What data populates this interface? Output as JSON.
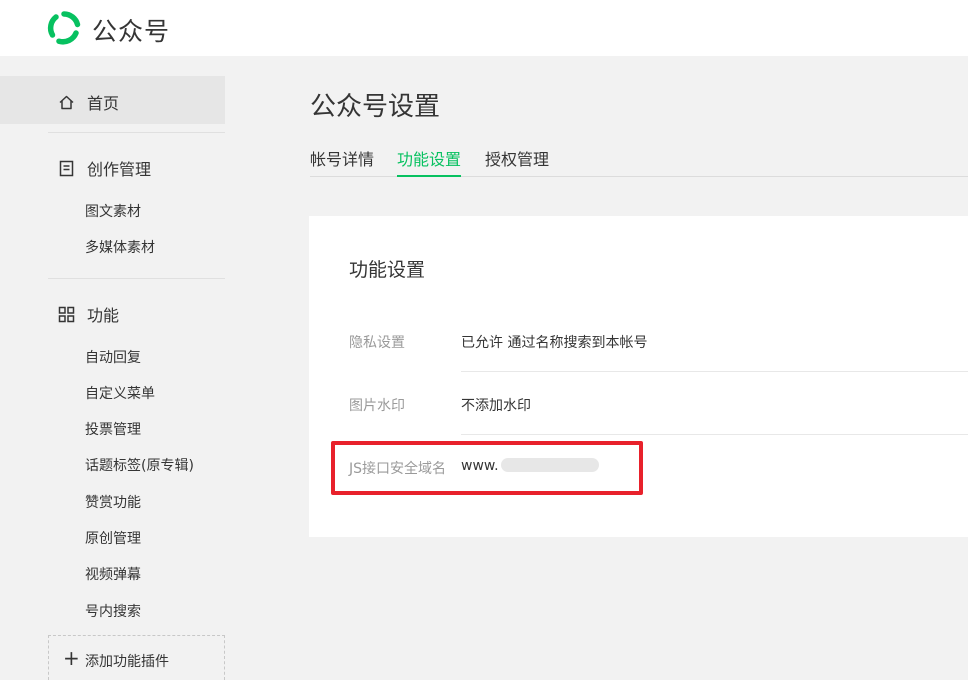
{
  "header": {
    "brand": "公众号",
    "logo_icon": "wechat-official-account-logo-icon",
    "accent_color": "#07c160"
  },
  "sidebar": {
    "home": {
      "label": "首页",
      "icon": "home-icon"
    },
    "creation": {
      "label": "创作管理",
      "icon": "document-icon",
      "items": [
        "图文素材",
        "多媒体素材"
      ]
    },
    "features": {
      "label": "功能",
      "icon": "grid-icon",
      "items": [
        "自动回复",
        "自定义菜单",
        "投票管理",
        "话题标签(原专辑)",
        "赞赏功能",
        "原创管理",
        "视频弹幕",
        "号内搜索"
      ]
    },
    "add_plugin": {
      "label": "添加功能插件",
      "icon": "plus-icon"
    }
  },
  "main": {
    "title": "公众号设置",
    "tabs": [
      {
        "label": "帐号详情",
        "active": false
      },
      {
        "label": "功能设置",
        "active": true
      },
      {
        "label": "授权管理",
        "active": false
      }
    ],
    "card": {
      "title": "功能设置",
      "rows": [
        {
          "label": "隐私设置",
          "value": "已允许 通过名称搜索到本帐号"
        },
        {
          "label": "图片水印",
          "value": "不添加水印"
        },
        {
          "label": "JS接口安全域名",
          "value": "www."
        }
      ]
    }
  }
}
